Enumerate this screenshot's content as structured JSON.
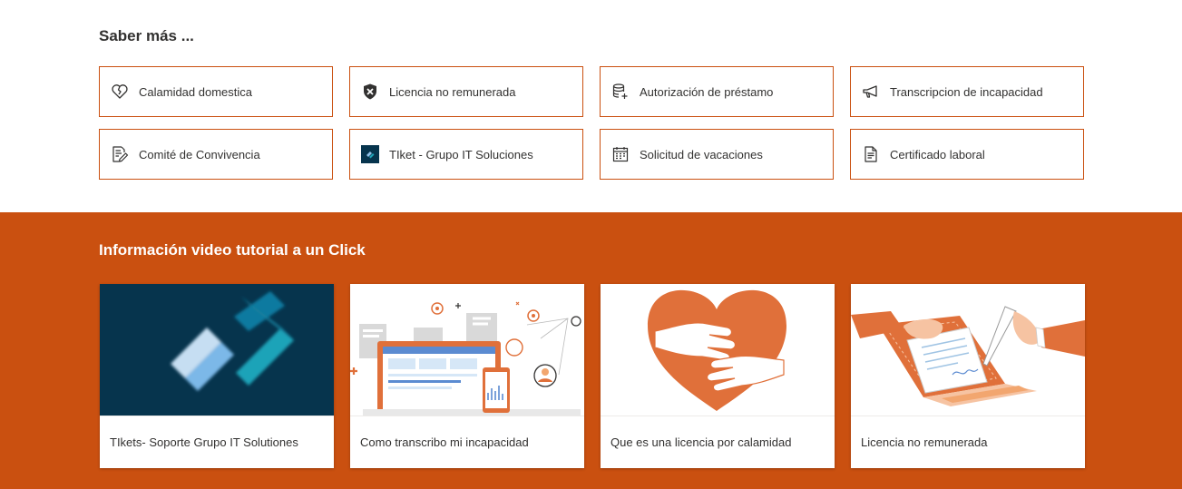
{
  "quick_links": {
    "title": "Saber más ...",
    "items": [
      {
        "label": "Calamidad domestica",
        "icon": "broken-heart-icon"
      },
      {
        "label": "Licencia no remunerada",
        "icon": "shield-x-icon"
      },
      {
        "label": "Autorización de préstamo",
        "icon": "database-add-icon"
      },
      {
        "label": "Transcripcion de incapacidad",
        "icon": "megaphone-icon"
      },
      {
        "label": "Comité de Convivencia",
        "icon": "document-edit-icon"
      },
      {
        "label": "TIket - Grupo IT Soluciones",
        "icon": "grupo-it-logo-icon"
      },
      {
        "label": "Solicitud de vacaciones",
        "icon": "calendar-icon"
      },
      {
        "label": "Certificado laboral",
        "icon": "document-text-icon"
      }
    ]
  },
  "videos": {
    "title": "Información video tutorial a un Click",
    "items": [
      {
        "caption": "TIkets- Soporte Grupo IT Solutiones",
        "thumbnail": "grupo-it-logo-thumbnail"
      },
      {
        "caption": "Como transcribo mi incapacidad",
        "thumbnail": "medical-laptop-illustration"
      },
      {
        "caption": "Que es una licencia por calamidad",
        "thumbnail": "heart-hug-illustration"
      },
      {
        "caption": "Licencia no remunerada",
        "thumbnail": "signing-document-illustration"
      }
    ]
  },
  "colors": {
    "accent": "#ca5010",
    "text": "#323130",
    "background": "#ffffff"
  }
}
